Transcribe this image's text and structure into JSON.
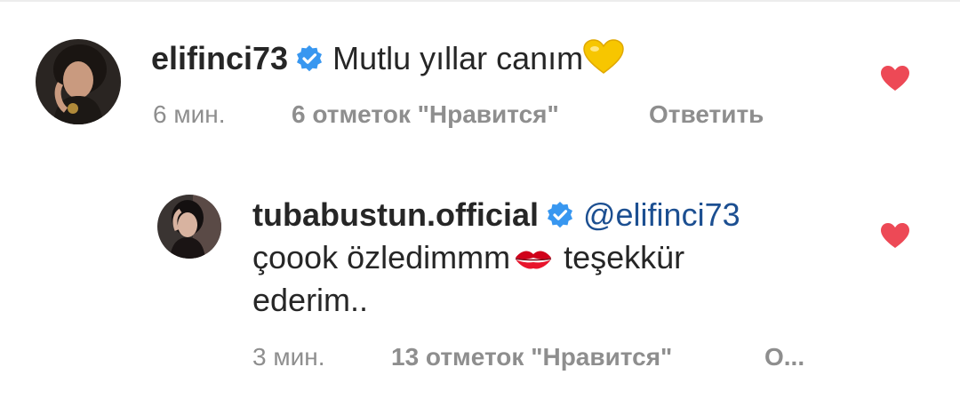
{
  "colors": {
    "verified_badge": "#3897f0",
    "like_heart": "#ed4956",
    "meta_text": "#8e8e8e",
    "mention": "#1c4f91"
  },
  "comment": {
    "username": "elifinci73",
    "text": "Mutlu yıllar canım",
    "emoji": "yellow-heart",
    "time": "6 мин.",
    "likes": "6 отметок \"Нравится\"",
    "reply": "Ответить",
    "liked": true
  },
  "reply_comment": {
    "username": "tubabustun.official",
    "mention": "@elifinci73",
    "text_line1": "çoook özledimmm",
    "emoji": "kiss-mark",
    "text_line1_after": "teşekkür",
    "text_line2": "ederim..",
    "time": "3 мин.",
    "likes": "13 отметок \"Нравится\"",
    "reply": "О...",
    "liked": true
  }
}
